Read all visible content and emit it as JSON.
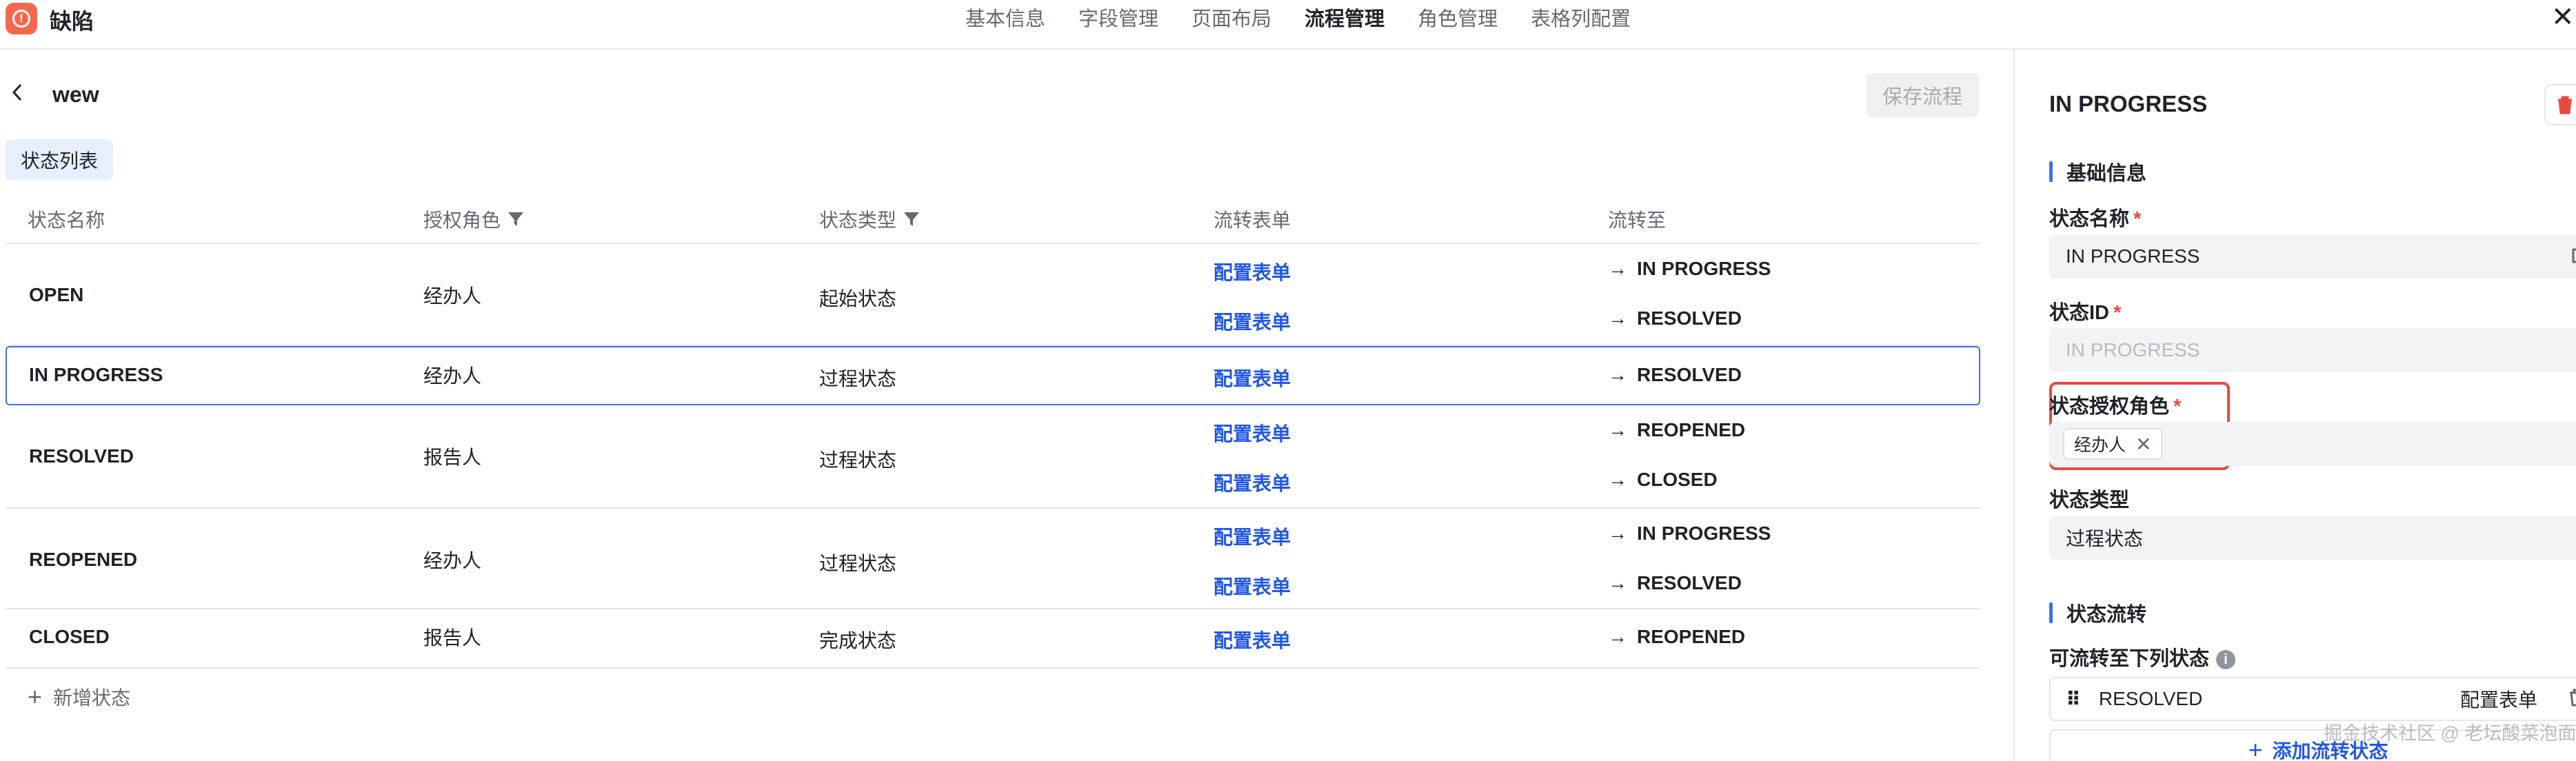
{
  "app": {
    "title": "缺陷",
    "icon": "alert-circle-icon"
  },
  "nav": {
    "items": [
      "基本信息",
      "字段管理",
      "页面布局",
      "流程管理",
      "角色管理",
      "表格列配置"
    ],
    "active_index": 3
  },
  "flow": {
    "name": "wew",
    "save_label": "保存流程",
    "tab_label": "状态列表"
  },
  "table": {
    "headers": [
      "状态名称",
      "授权角色",
      "状态类型",
      "流转表单",
      "流转至"
    ],
    "rows": [
      {
        "name": "OPEN",
        "role": "经办人",
        "type": "起始状态",
        "transitions": [
          {
            "form": "配置表单",
            "to": "IN PROGRESS"
          },
          {
            "form": "配置表单",
            "to": "RESOLVED"
          }
        ]
      },
      {
        "name": "IN PROGRESS",
        "role": "经办人",
        "type": "过程状态",
        "selected": true,
        "transitions": [
          {
            "form": "配置表单",
            "to": "RESOLVED"
          }
        ]
      },
      {
        "name": "RESOLVED",
        "role": "报告人",
        "type": "过程状态",
        "transitions": [
          {
            "form": "配置表单",
            "to": "REOPENED"
          },
          {
            "form": "配置表单",
            "to": "CLOSED"
          }
        ]
      },
      {
        "name": "REOPENED",
        "role": "经办人",
        "type": "过程状态",
        "transitions": [
          {
            "form": "配置表单",
            "to": "IN PROGRESS"
          },
          {
            "form": "配置表单",
            "to": "RESOLVED"
          }
        ]
      },
      {
        "name": "CLOSED",
        "role": "报告人",
        "type": "完成状态",
        "transitions": [
          {
            "form": "配置表单",
            "to": "REOPENED"
          }
        ]
      }
    ],
    "add_label": "新增状态"
  },
  "detail": {
    "title": "IN PROGRESS",
    "basic_section": "基础信息",
    "name_label": "状态名称",
    "name_value": "IN PROGRESS",
    "id_label": "状态ID",
    "id_placeholder": "IN PROGRESS",
    "role_label": "状态授权角色",
    "role_tag": "经办人",
    "type_label": "状态类型",
    "type_value": "过程状态",
    "flow_section": "状态流转",
    "flow_to_label": "可流转至下列状态",
    "flow_items": [
      {
        "name": "RESOLVED",
        "form": "配置表单"
      }
    ],
    "add_flow_label": "添加流转状态",
    "required_mark": "*"
  },
  "watermark": "掘金技术社区 @ 老坛酸菜泡面",
  "colors": {
    "accent": "#2157e6",
    "brand": "#f4684d",
    "danger": "#e8483f"
  }
}
